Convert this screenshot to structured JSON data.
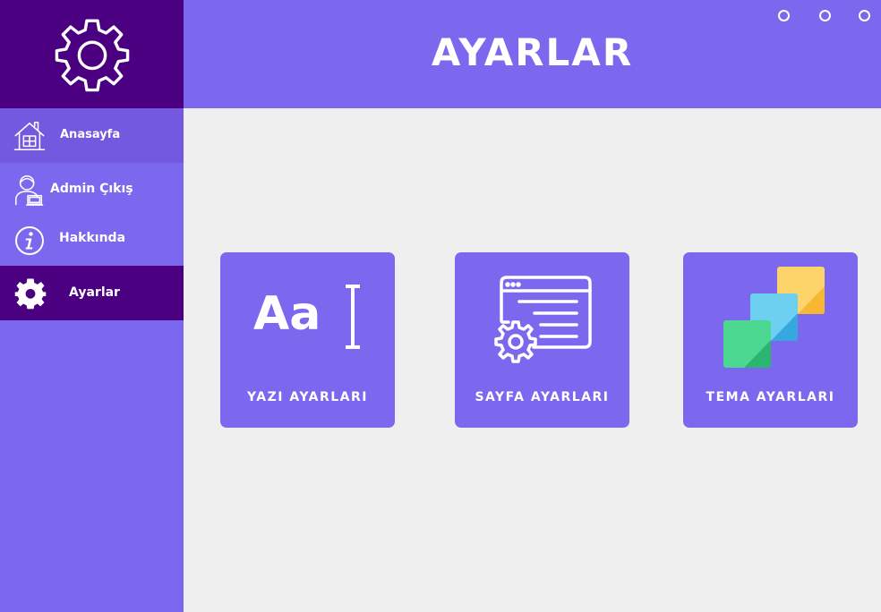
{
  "sidebar": {
    "items": [
      {
        "label": "Anasayfa",
        "icon": "home-icon"
      },
      {
        "label": "Admin Çıkış",
        "icon": "admin-logout-icon"
      },
      {
        "label": "Hakkında",
        "icon": "info-icon"
      },
      {
        "label": "Ayarlar",
        "icon": "gear-icon"
      }
    ]
  },
  "header": {
    "title": "AYARLAR"
  },
  "cards": [
    {
      "label": "YAZI AYARLARI",
      "icon": "font-icon",
      "icon_text": "Aa"
    },
    {
      "label": "SAYFA AYARLARI",
      "icon": "page-settings-icon"
    },
    {
      "label": "TEMA AYARLARI",
      "icon": "theme-layers-icon"
    }
  ],
  "colors": {
    "accent": "#7b68ee",
    "dark": "#4b0082",
    "background": "#efefef"
  }
}
